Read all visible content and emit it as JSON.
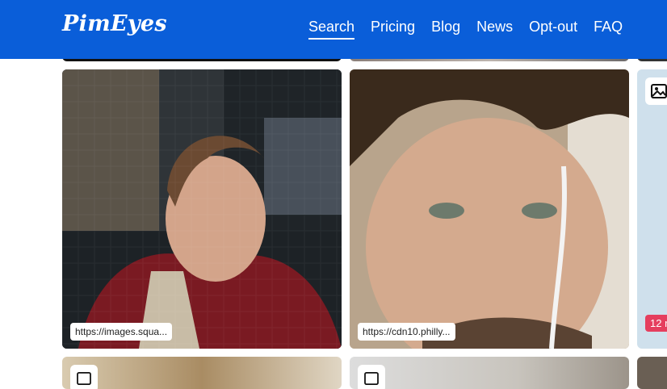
{
  "header": {
    "logo": "PimEyes",
    "nav": [
      {
        "label": "Search",
        "active": true
      },
      {
        "label": "Pricing"
      },
      {
        "label": "Blog"
      },
      {
        "label": "News"
      },
      {
        "label": "Opt-out"
      },
      {
        "label": "FAQ"
      }
    ]
  },
  "results": [
    {
      "url": "https://images.squa..."
    },
    {
      "url": "https://cdn10.philly..."
    },
    {
      "badge": "12 r"
    }
  ],
  "colors": {
    "brand": "#0a5ed9",
    "badge": "#e53e5e"
  },
  "icons": {
    "result_type": "image-icon"
  }
}
